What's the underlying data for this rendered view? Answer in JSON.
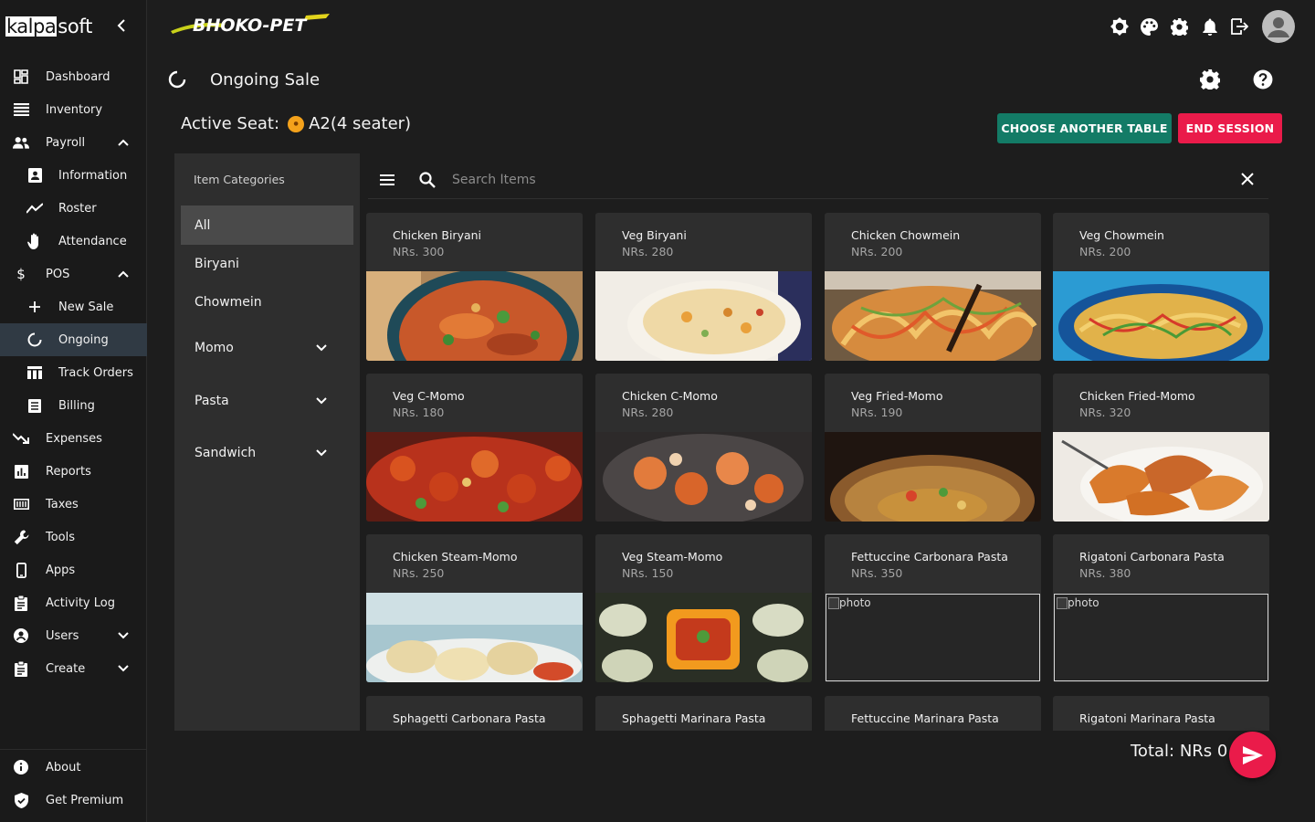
{
  "brand": {
    "box": "kalpa",
    "rest": "soft"
  },
  "logo": {
    "text": "BHOKO-PET"
  },
  "sidebar": {
    "items": [
      {
        "label": "Dashboard",
        "icon": "dashboard-icon"
      },
      {
        "label": "Inventory",
        "icon": "inventory-icon"
      },
      {
        "label": "Payroll",
        "icon": "payroll-icon"
      },
      {
        "label": "Information",
        "icon": "badge-icon"
      },
      {
        "label": "Roster",
        "icon": "roster-icon"
      },
      {
        "label": "Attendance",
        "icon": "hand-icon"
      },
      {
        "label": "POS",
        "icon": "dollar-icon"
      },
      {
        "label": "New Sale",
        "icon": "plus-icon"
      },
      {
        "label": "Ongoing",
        "icon": "loading-icon"
      },
      {
        "label": "Track Orders",
        "icon": "table-icon"
      },
      {
        "label": "Billing",
        "icon": "receipt-icon"
      },
      {
        "label": "Expenses",
        "icon": "trend-down-icon"
      },
      {
        "label": "Reports",
        "icon": "bar-chart-icon"
      },
      {
        "label": "Taxes",
        "icon": "calculator-icon"
      },
      {
        "label": "Tools",
        "icon": "wrench-icon"
      },
      {
        "label": "Apps",
        "icon": "phone-icon"
      },
      {
        "label": "Activity Log",
        "icon": "clipboard-icon"
      },
      {
        "label": "Users",
        "icon": "user-circle-icon"
      },
      {
        "label": "Create",
        "icon": "clipboard-plus-icon"
      }
    ],
    "about": "About",
    "premium": "Get Premium"
  },
  "header": {
    "title": "Ongoing Sale"
  },
  "seat": {
    "label": "Active Seat:",
    "value": "A2(4 seater)"
  },
  "buttons": {
    "choose": "CHOOSE ANOTHER TABLE",
    "end": "END SESSION"
  },
  "categories": {
    "heading": "Item Categories",
    "items": [
      "All",
      "Biryani",
      "Chowmein",
      "Momo",
      "Pasta",
      "Sandwich"
    ]
  },
  "search": {
    "placeholder": "Search Items"
  },
  "products": [
    {
      "name": "Chicken Biryani",
      "price": "NRs. 300"
    },
    {
      "name": "Veg Biryani",
      "price": "NRs. 280"
    },
    {
      "name": "Chicken Chowmein",
      "price": "NRs. 200"
    },
    {
      "name": "Veg Chowmein",
      "price": "NRs. 200"
    },
    {
      "name": "Veg C-Momo",
      "price": "NRs. 180"
    },
    {
      "name": "Chicken C-Momo",
      "price": "NRs. 280"
    },
    {
      "name": "Veg Fried-Momo",
      "price": "NRs. 190"
    },
    {
      "name": "Chicken Fried-Momo",
      "price": "NRs. 320"
    },
    {
      "name": "Chicken Steam-Momo",
      "price": "NRs. 250"
    },
    {
      "name": "Veg Steam-Momo",
      "price": "NRs. 150"
    },
    {
      "name": "Fettuccine Carbonara Pasta",
      "price": "NRs. 350",
      "alt": "photo"
    },
    {
      "name": "Rigatoni Carbonara Pasta",
      "price": "NRs. 380",
      "alt": "photo"
    },
    {
      "name": "Sphagetti Carbonara Pasta",
      "price": ""
    },
    {
      "name": "Sphagetti Marinara Pasta",
      "price": ""
    },
    {
      "name": "Fettuccine Marinara Pasta",
      "price": ""
    },
    {
      "name": "Rigatoni Marinara Pasta",
      "price": ""
    }
  ],
  "footer": {
    "total": "Total: NRs 0"
  },
  "colors": {
    "accent_teal": "#137b66",
    "accent_red": "#ea1b4a",
    "seat_dot": "#f4a21b"
  }
}
